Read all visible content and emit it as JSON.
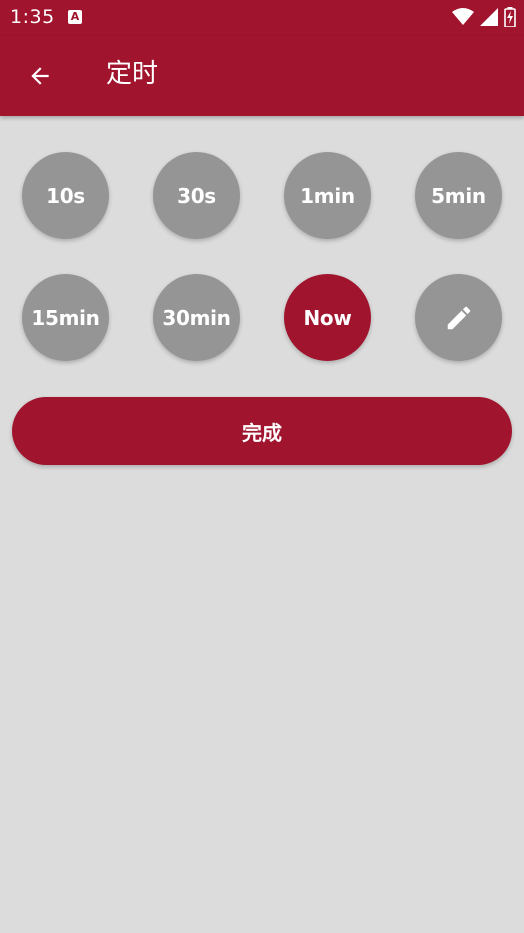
{
  "status_bar": {
    "time": "1:35",
    "notification_icon": "A",
    "icons": [
      "wifi-icon",
      "signal-icon",
      "battery-charging-icon"
    ]
  },
  "app_bar": {
    "back_icon": "arrow-back-icon",
    "title": "定时"
  },
  "timer_options": [
    {
      "label": "10s",
      "selected": false
    },
    {
      "label": "30s",
      "selected": false
    },
    {
      "label": "1min",
      "selected": false
    },
    {
      "label": "5min",
      "selected": false
    },
    {
      "label": "15min",
      "selected": false
    },
    {
      "label": "30min",
      "selected": false
    },
    {
      "label": "Now",
      "selected": true
    },
    {
      "icon": "edit-pencil-icon",
      "selected": false
    }
  ],
  "done_button": {
    "label": "完成"
  },
  "colors": {
    "accent": "#a0142e",
    "option_inactive": "#959595",
    "background": "#dcdcdc",
    "text_on_accent": "#ffffff"
  }
}
